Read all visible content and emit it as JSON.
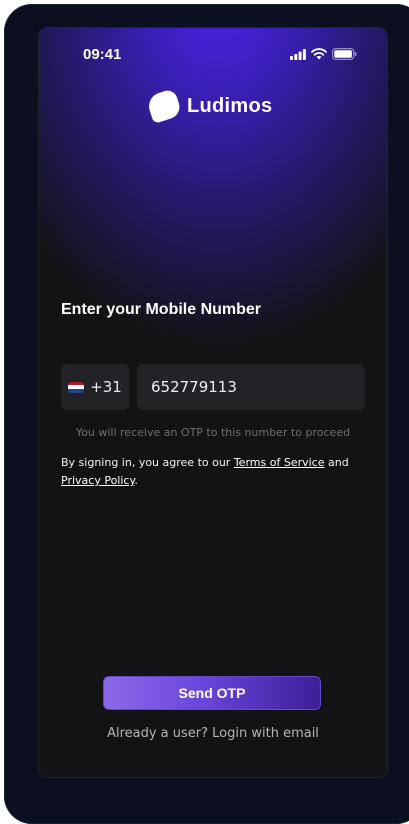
{
  "status_bar": {
    "time": "09:41"
  },
  "brand": {
    "name": "Ludimos"
  },
  "form": {
    "heading": "Enter your Mobile Number",
    "country_code": "+31",
    "phone_value": "652779113",
    "hint": "You will receive an OTP to this number to proceed",
    "terms_prefix": "By signing in, you agree to our ",
    "terms_link": "Terms of Service",
    "terms_middle": " and ",
    "privacy_link": "Privacy Policy",
    "terms_suffix": "."
  },
  "actions": {
    "send_label": "Send OTP",
    "login_prompt": "Already a user? Login with email"
  },
  "colors": {
    "accent_start": "#8c6ae6",
    "accent_end": "#3d1f96",
    "glow": "#4b22e8",
    "background": "#131316"
  },
  "flag_colors": [
    "#ae1c28",
    "#ffffff",
    "#21468b"
  ]
}
